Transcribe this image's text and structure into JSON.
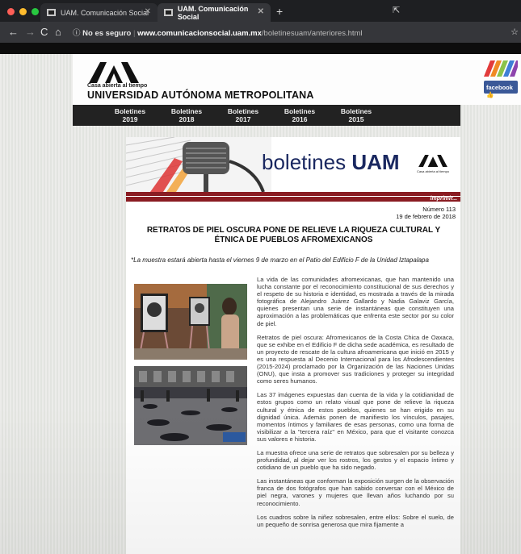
{
  "browser": {
    "tabs": [
      {
        "title": "UAM. Comunicación Social",
        "active": false
      },
      {
        "title": "UAM. Comunicación Social",
        "active": true
      }
    ],
    "new_tab": "+",
    "security_label": "No es seguro",
    "url_domain": "www.comunicacionsocial.uam.mx",
    "url_path": "/boletinesuam/anteriores.html"
  },
  "header": {
    "tagline": "Casa abierta al tiempo",
    "university": "UNIVERSIDAD AUTÓNOMA METROPOLITANA",
    "facebook_label": "facebook"
  },
  "nav": {
    "items": [
      {
        "label": "Boletines",
        "year": "2019"
      },
      {
        "label": "Boletines",
        "year": "2018"
      },
      {
        "label": "Boletines",
        "year": "2017"
      },
      {
        "label": "Boletines",
        "year": "2016"
      },
      {
        "label": "Boletines",
        "year": "2015"
      }
    ]
  },
  "banner": {
    "word1": "boletines",
    "word2": "UAM",
    "tagline": "Casa abierta al tiempo"
  },
  "article": {
    "print_label": "imprimir...",
    "number": "Número 113",
    "date": "19 de febrero de 2018",
    "title": "RETRATOS DE PIEL OSCURA PONE DE RELIEVE LA RIQUEZA CULTURAL Y ÉTNICA DE PUEBLOS AFROMEXICANOS",
    "subtitle": "*La muestra estará abierta hasta el viernes 9 de marzo en el Patio del Edificio F de la Unidad Iztapalapa",
    "paragraphs": [
      "La vida de las comunidades afromexicanas, que han mantenido una lucha constante por el reconocimiento constitucional de sus derechos y el respeto de su historia e identidad, es mostrada a través de la mirada fotográfica de Alejandro Juárez Gallardo y Nadia Galaviz García, quienes presentan una serie de instantáneas que constituyen una aproximación a las problemáticas que enfrenta este sector por su color de piel.",
      "Retratos de piel oscura: Afromexicanos de la Costa Chica de Oaxaca, que se exhibe en el Edificio F de dicha sede académica, es resultado de un proyecto de rescate de la cultura afroamericana que inició en 2015 y es una respuesta al Decenio Internacional para los Afrodescendientes (2015-2024) proclamado por la Organización de las Naciones Unidas (ONU), que insta a promover sus tradiciones y proteger su integridad como seres humanos.",
      "Las 37 imágenes expuestas dan cuenta de la vida y la cotidianidad de estos grupos como un relato visual que pone de relieve la riqueza cultural y étnica de estos pueblos, quienes se han erigido en su dignidad única. Además ponen de manifiesto los vínculos, pasajes, momentos íntimos y familiares de esas personas, como una forma de visibilizar a la \"tercera raíz\" en México, para que el visitante conozca sus valores e historia.",
      "La muestra ofrece una serie de retratos que sobresalen por su belleza y profundidad, al dejar ver los rostros, los gestos y el espacio íntimo y cotidiano de un pueblo que ha sido negado.",
      "Las instantáneas que conforman la exposición surgen de la observación franca de dos fotógrafos que han sabido conversar con el México de piel negra, varones y mujeres que llevan años luchando por su reconocimiento.",
      "Los cuadros sobre la niñez sobresalen, entre ellos: Sobre el suelo, de un pequeño de sonrisa generosa que mira fijamente a"
    ]
  },
  "colors": {
    "accent_red": "#8a1c22",
    "title_blue": "#1a2860",
    "chrome_dark": "#35363a"
  }
}
